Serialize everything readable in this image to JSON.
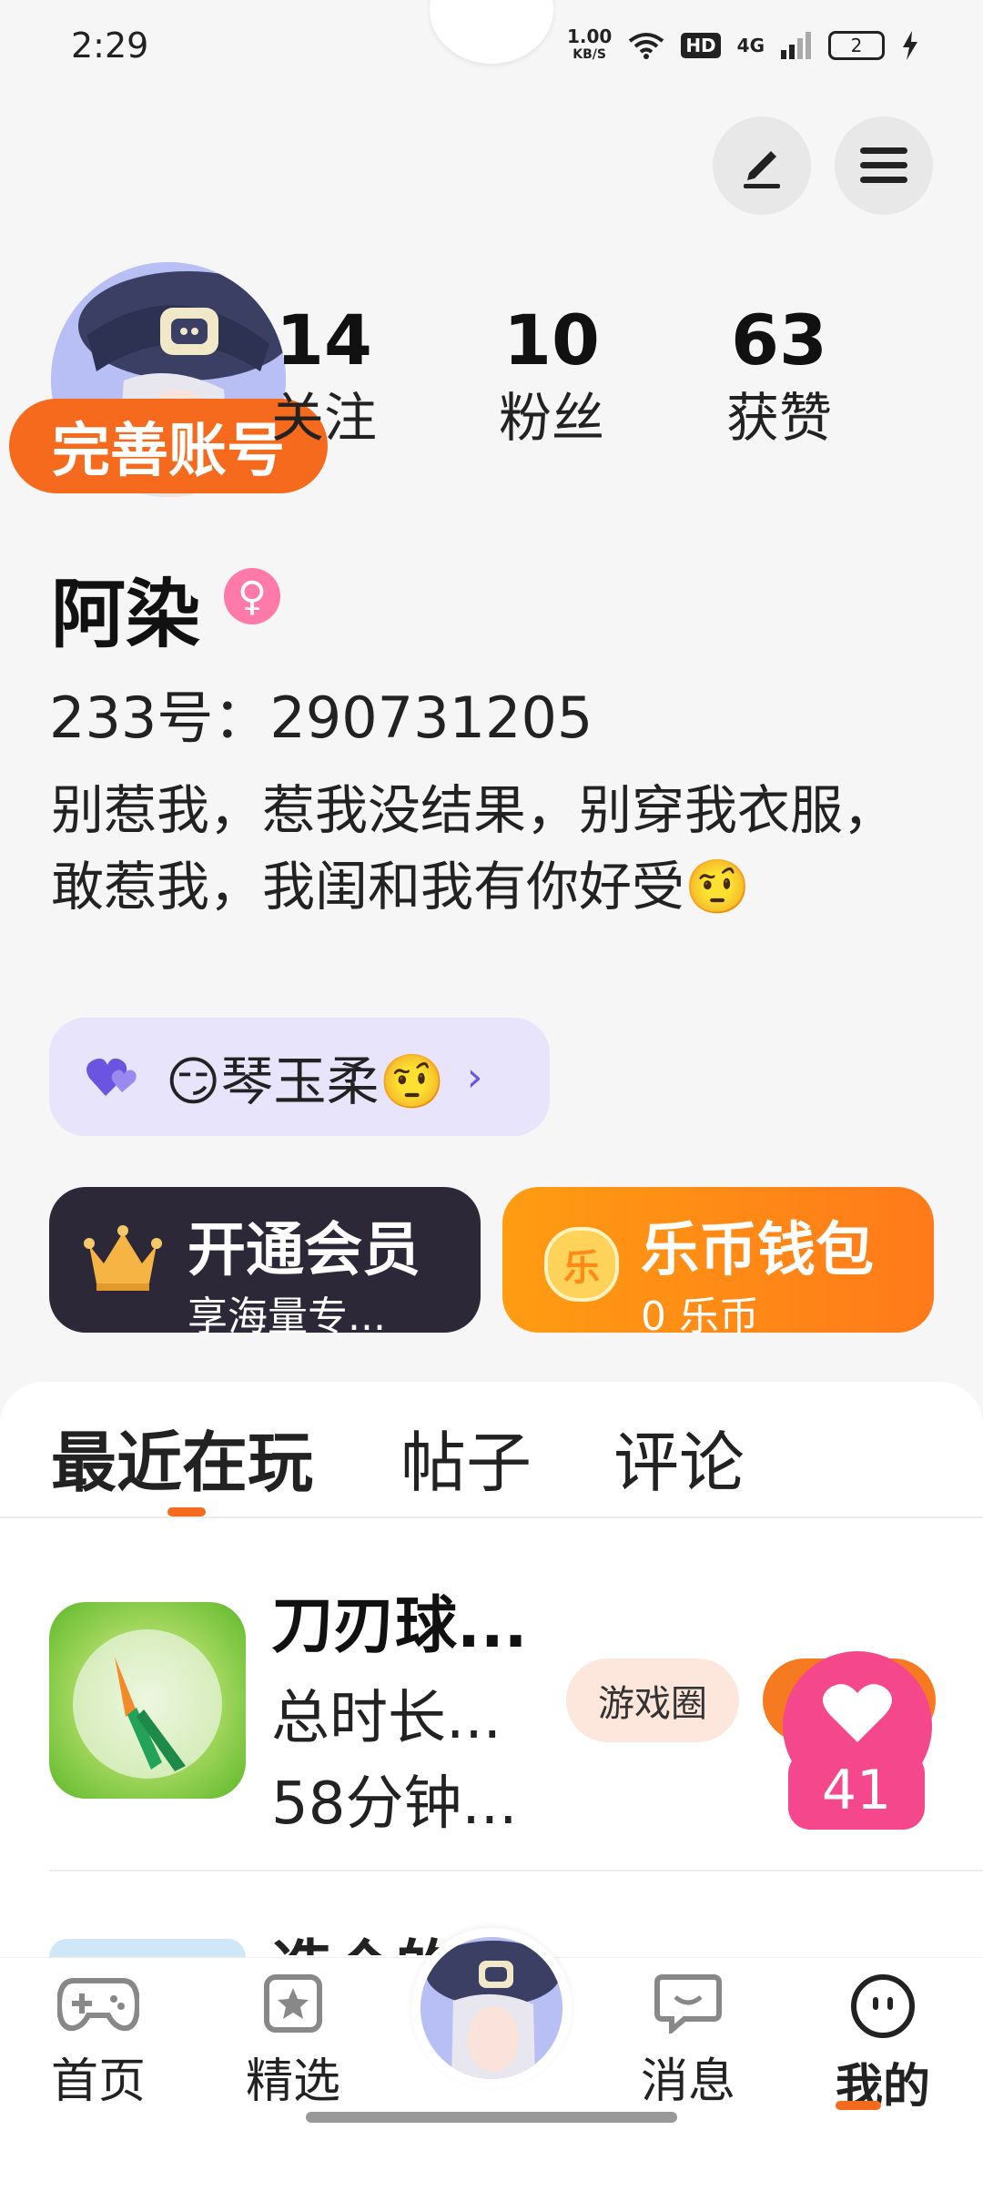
{
  "status_bar": {
    "time": "2:29",
    "net_speed_value": "1.00",
    "net_speed_unit": "KB/S",
    "hd": "HD",
    "signal": "4G",
    "battery": "2"
  },
  "profile": {
    "complete_account": "完善账号",
    "stats": [
      {
        "value": "14",
        "label": "关注"
      },
      {
        "value": "10",
        "label": "粉丝"
      },
      {
        "value": "63",
        "label": "获赞"
      }
    ],
    "username": "阿染",
    "gender_symbol": "♀",
    "account_id": "233号：290731205",
    "bio": "别惹我，惹我没结果，别穿我衣服，敢惹我，我闺和我有你好受🤨",
    "club": {
      "name": "😏琴玉柔🤨",
      "chevron": "›"
    }
  },
  "promos": {
    "vip": {
      "title": "开通会员",
      "subtitle": "享海量专..."
    },
    "wallet": {
      "title": "乐币钱包",
      "subtitle": "0 乐币",
      "coin_char": "乐"
    }
  },
  "tabs": [
    {
      "label": "最近在玩",
      "active": true
    },
    {
      "label": "帖子",
      "active": false
    },
    {
      "label": "评论",
      "active": false
    }
  ],
  "games": [
    {
      "title": "刀刃球...",
      "duration_label": "总时长...",
      "duration_value": "58分钟...",
      "circle_chip": "游戏圈"
    }
  ],
  "next_item_title": "造个的",
  "like_count": "41",
  "bottom_nav": [
    {
      "label": "首页",
      "icon": "gamepad-icon"
    },
    {
      "label": "精选",
      "icon": "star-bookmark-icon"
    },
    {
      "label": "消息",
      "icon": "chat-bubble-icon"
    },
    {
      "label": "我的",
      "icon": "smiley-face-icon"
    }
  ],
  "colors": {
    "accent": "#f56a1d",
    "like_pink": "#f4478c",
    "vip_dark": "#2c2838",
    "wallet_orange": "#ff8a16"
  }
}
